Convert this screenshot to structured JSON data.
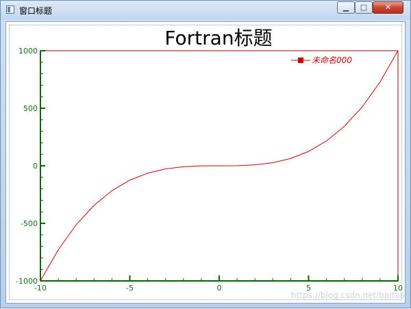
{
  "window": {
    "title": "窗口标题",
    "minimize_glyph": "▁",
    "maximize_glyph": "□",
    "close_glyph": "✕"
  },
  "chart_data": {
    "type": "line",
    "title": "Fortran标题",
    "xlim": [
      -10,
      10
    ],
    "ylim": [
      -1000,
      1000
    ],
    "xticks": [
      -10,
      -5,
      0,
      5,
      10
    ],
    "yticks": [
      -1000,
      -500,
      0,
      500,
      1000
    ],
    "grid": false,
    "legend_placement": "top-right",
    "series": [
      {
        "name": "未命名000",
        "color": "#cc0000",
        "x": [
          -10,
          -9,
          -8,
          -7,
          -6,
          -5,
          -4,
          -3,
          -2,
          -1,
          0,
          1,
          2,
          3,
          4,
          5,
          6,
          7,
          8,
          9,
          10
        ],
        "y": [
          -1000,
          -729,
          -512,
          -343,
          -216,
          -125,
          -64,
          -27,
          -8,
          -1,
          0,
          1,
          8,
          27,
          64,
          125,
          216,
          343,
          512,
          729,
          1000
        ]
      }
    ],
    "axis_color": "#006400",
    "frame_color": "#990000"
  },
  "watermark": "https://blog.csdn.net/baitao"
}
